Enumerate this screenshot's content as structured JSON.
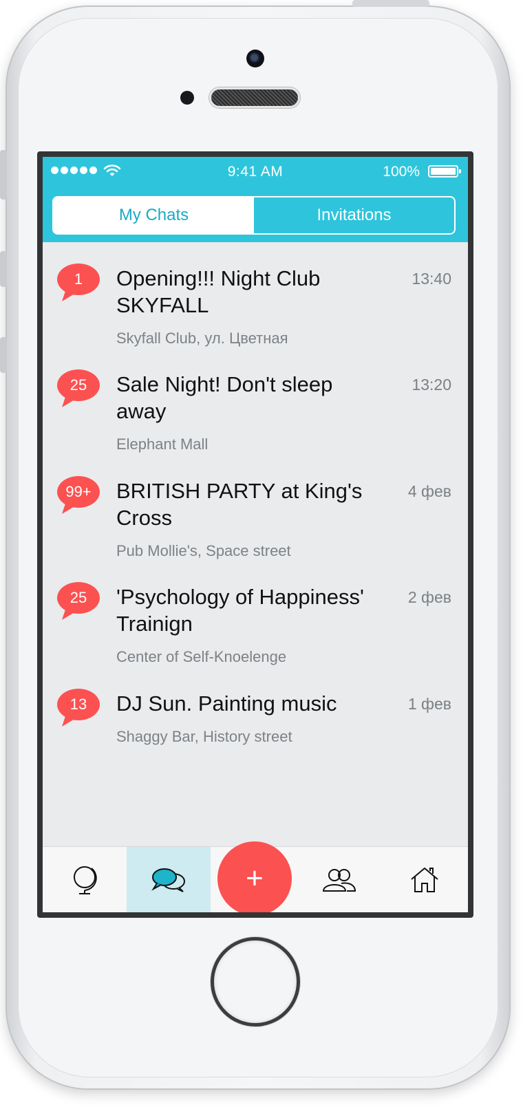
{
  "status_bar": {
    "time": "9:41 AM",
    "battery": "100%"
  },
  "segment": {
    "tabs": [
      "My Chats",
      "Invitations"
    ],
    "active": "My Chats"
  },
  "chats": [
    {
      "badge": "1",
      "title": "Opening!!! Night Club SKYFALL",
      "location": "Skyfall Club, ул. Цветная",
      "time": "13:40"
    },
    {
      "badge": "25",
      "title": "Sale Night! Don't sleep away",
      "location": "Elephant Mall",
      "time": "13:20"
    },
    {
      "badge": "99+",
      "title": "BRITISH PARTY at King's Cross",
      "location": "Pub Mollie's, Space street",
      "time": "4 фев"
    },
    {
      "badge": "25",
      "title": "'Psychology of Happiness' Trainign",
      "location": "Center of Self-Knoelenge",
      "time": "2 фев"
    },
    {
      "badge": "13",
      "title": "DJ Sun. Painting music",
      "location": "Shaggy Bar, History street",
      "time": "1 фев"
    }
  ],
  "tabbar": {
    "items": [
      "globe-icon",
      "chats-icon",
      "add-icon",
      "people-icon",
      "home-icon"
    ],
    "active": "chats-icon",
    "fab_label": "+"
  },
  "colors": {
    "accent": "#2ec5dc",
    "badge": "#fc5151",
    "background": "#e9ebed"
  }
}
